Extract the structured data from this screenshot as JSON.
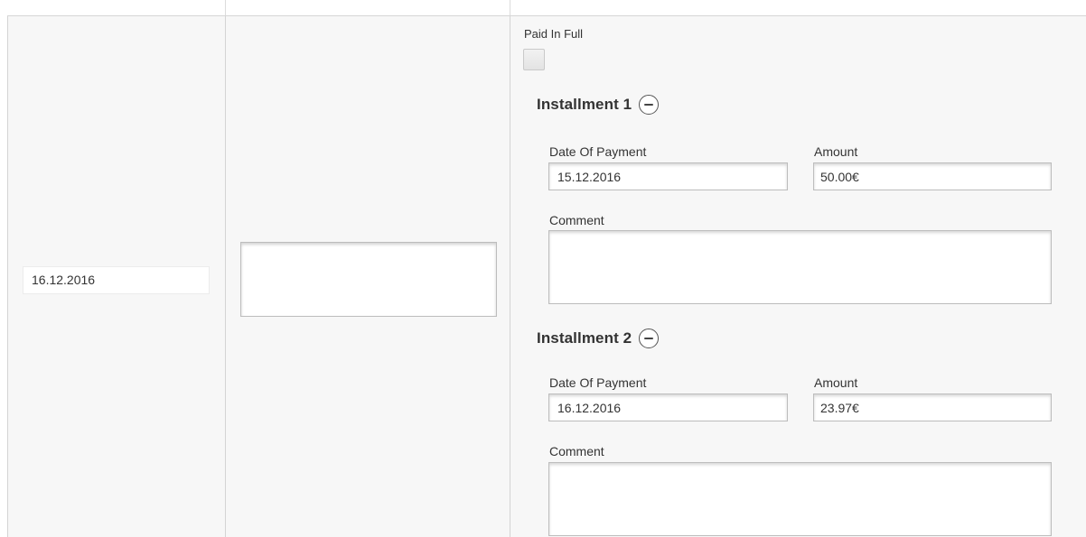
{
  "row": {
    "date": "16.12.2016",
    "middle_value": ""
  },
  "payment": {
    "paid_in_full_label": "Paid In Full",
    "paid_in_full_checked": false,
    "installments": [
      {
        "title": "Installment 1",
        "date_label": "Date Of Payment",
        "date_value": "15.12.2016",
        "amount_label": "Amount",
        "amount_value": "50.00€",
        "comment_label": "Comment",
        "comment_value": ""
      },
      {
        "title": "Installment 2",
        "date_label": "Date Of Payment",
        "date_value": "16.12.2016",
        "amount_label": "Amount",
        "amount_value": "23.97€",
        "comment_label": "Comment",
        "comment_value": ""
      }
    ]
  },
  "icons": {
    "remove_installment": "minus-circle-icon"
  }
}
